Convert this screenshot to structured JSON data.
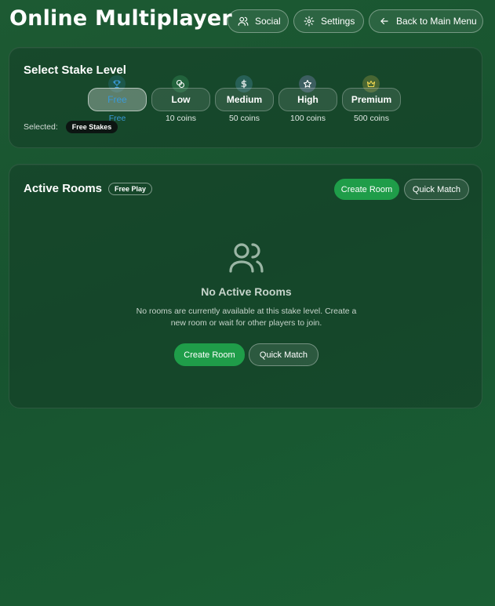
{
  "header": {
    "title": "Online Multiplayer",
    "buttons": {
      "social": "Social",
      "settings": "Settings",
      "back": "Back to Main Menu"
    }
  },
  "stake": {
    "title": "Select Stake Level",
    "options": [
      {
        "label": "Free",
        "sub": "Free",
        "icon": "trophy-icon",
        "icon_color": "#3a9ad9",
        "selected": true
      },
      {
        "label": "Low",
        "sub": "10 coins",
        "icon": "coins-icon",
        "icon_color": "#4cc27a",
        "selected": false
      },
      {
        "label": "Medium",
        "sub": "50 coins",
        "icon": "dollar-icon",
        "icon_color": "#5aa7d8",
        "selected": false
      },
      {
        "label": "High",
        "sub": "100 coins",
        "icon": "star-icon",
        "icon_color": "#c9c9ff",
        "selected": false
      },
      {
        "label": "Premium",
        "sub": "500 coins",
        "icon": "crown-icon",
        "icon_color": "#e0c54a",
        "selected": false
      }
    ],
    "selected_label": "Selected:",
    "selected_value": "Free Stakes"
  },
  "rooms": {
    "title": "Active Rooms",
    "badge": "Free Play",
    "create_label": "Create Room",
    "quick_label": "Quick Match",
    "empty_title": "No Active Rooms",
    "empty_desc": "No rooms are currently available at this stake level. Create a new room or wait for other players to join.",
    "empty_icon": "users-icon"
  },
  "colors": {
    "accent_green": "#1f9d49",
    "selected_blue": "#3a9ad9",
    "background": "#1a5732"
  }
}
